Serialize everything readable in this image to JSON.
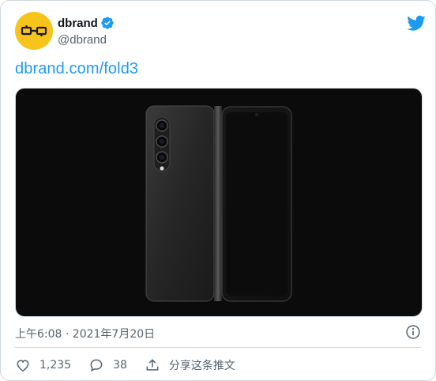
{
  "account": {
    "display_name": "dbrand",
    "handle": "@dbrand",
    "avatar_color": "#f7c41b",
    "verified": true,
    "verified_color": "#1d9bf0"
  },
  "tweet": {
    "link_text": "dbrand.com/fold3",
    "timestamp": "上午6:08 · 2021年7月20日"
  },
  "media": {
    "description_icon": "phone-image",
    "background": "#0b0b0b"
  },
  "actions": {
    "likes": "1,235",
    "replies": "38",
    "share_label": "分享这条推文"
  },
  "colors": {
    "accent": "#1d9bf0",
    "muted_text": "#536471",
    "border": "#cfd9de"
  }
}
